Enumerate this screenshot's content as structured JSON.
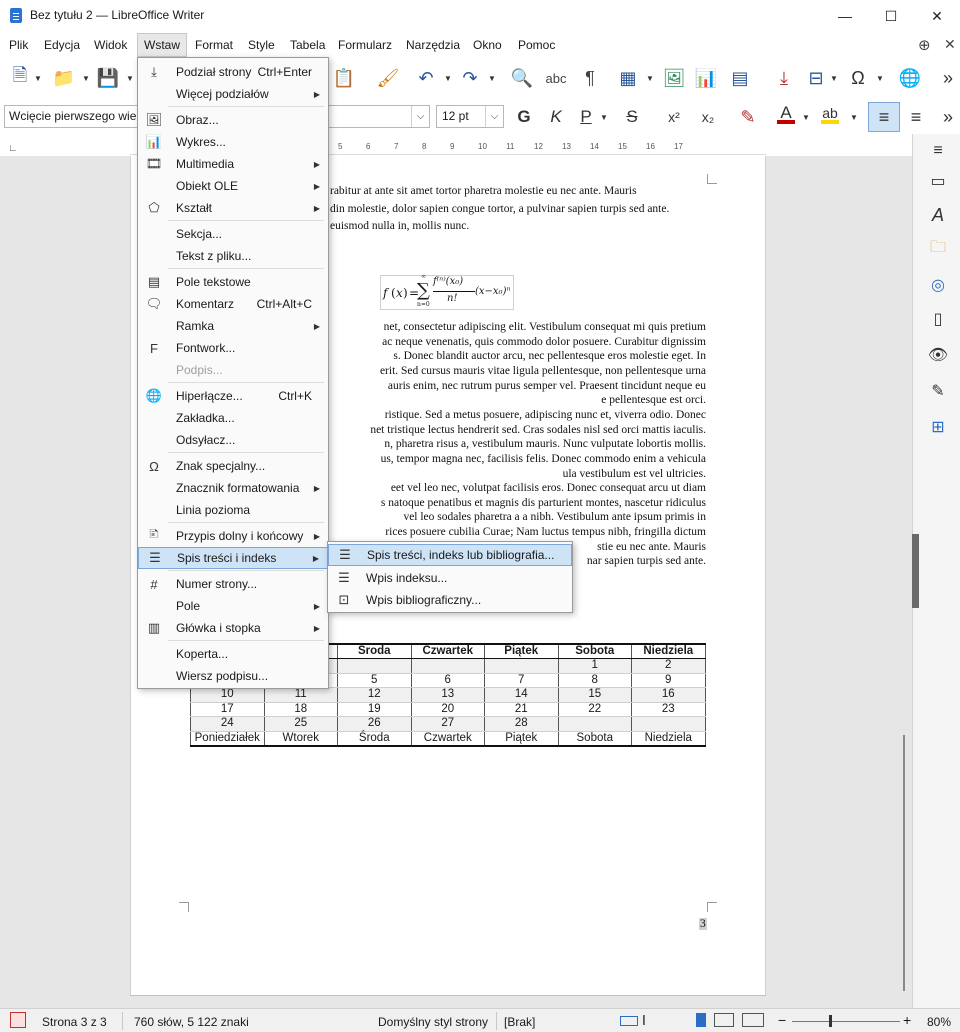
{
  "window": {
    "title": "Bez tytułu 2 — LibreOffice Writer",
    "controls": {
      "minimize": "—",
      "maximize": "☐",
      "close": "✕"
    }
  },
  "menubar": {
    "items": [
      "Plik",
      "Edycja",
      "Widok",
      "Wstaw",
      "Format",
      "Style",
      "Tabela",
      "Formularz",
      "Narzędzia",
      "Okno",
      "Pomoc"
    ],
    "active": "Wstaw"
  },
  "formatting": {
    "paragraph_style": "Wcięcie pierwszego wiersza",
    "font_size": "12 pt",
    "bold": "G",
    "italic": "K",
    "underline": "P",
    "strike": "S",
    "superscript": "x²",
    "subscript": "x₂",
    "font_color": "#c00000",
    "highlight_color": "#ffd700"
  },
  "ruler": {
    "numbers": [
      "5",
      "6",
      "7",
      "8",
      "9",
      "10",
      "11",
      "12",
      "13",
      "14",
      "15",
      "16",
      "17"
    ]
  },
  "document": {
    "para1": [
      "rabitur at ante sit amet tortor pharetra molestie eu nec ante. Mauris",
      "din molestie, dolor sapien congue tortor, a pulvinar sapien turpis sed ante.",
      "euismod nulla in, mollis nunc."
    ],
    "para2": [
      "net, consectetur adipiscing elit. Vestibulum consequat mi quis pretium",
      "ac neque venenatis, quis commodo dolor posuere. Curabitur dignissim",
      "s. Donec blandit auctor arcu, nec pellentesque eros molestie eget. In",
      "erit. Sed cursus mauris vitae ligula pellentesque, non pellentesque urna",
      "auris enim, nec rutrum purus semper vel. Praesent tincidunt neque eu",
      "e pellentesque est orci.",
      "ristique. Sed a metus posuere, adipiscing nunc et, viverra odio. Donec",
      "net tristique lectus hendrerit sed. Cras sodales nisl sed orci mattis iaculis.",
      "n, pharetra risus a, vestibulum mauris. Nunc vulputate lobortis mollis.",
      "us, tempor magna nec, facilisis felis. Donec commodo enim a vehicula",
      "ula vestibulum est vel ultricies.",
      "eet vel leo nec, volutpat facilisis eros. Donec consequat arcu ut diam",
      "s natoque penatibus et magnis dis parturient montes, nascetur ridiculus",
      "vel leo sodales pharetra a a nibh. Vestibulum ante ipsum primis in",
      "rices posuere cubilia Curae; Nam luctus tempus nibh, fringilla dictum",
      "stie eu nec ante. Mauris",
      "nar sapien turpis sed ante."
    ],
    "formula": {
      "f": "f",
      "x": "x",
      "eq": "=",
      "sum": "∑",
      "sum_top": "∞",
      "sum_bottom": "n=0",
      "num": "f⁽ⁿ⁾(x₀)",
      "den": "n!",
      "tail": "(x−x₀)ⁿ"
    },
    "page_number": "3",
    "calendar": {
      "header": [
        "",
        "",
        "Środa",
        "Czwartek",
        "Piątek",
        "Sobota",
        "Niedziela"
      ],
      "rows": [
        [
          "",
          "",
          "",
          "",
          "",
          "1",
          "2"
        ],
        [
          "",
          "",
          "5",
          "6",
          "7",
          "8",
          "9"
        ],
        [
          "10",
          "11",
          "12",
          "13",
          "14",
          "15",
          "16"
        ],
        [
          "17",
          "18",
          "19",
          "20",
          "21",
          "22",
          "23"
        ],
        [
          "24",
          "25",
          "26",
          "27",
          "28",
          "",
          ""
        ]
      ],
      "footer": [
        "Poniedziałek",
        "Wtorek",
        "Środa",
        "Czwartek",
        "Piątek",
        "Sobota",
        "Niedziela"
      ]
    }
  },
  "insert_menu": {
    "items": [
      {
        "label": "Podział strony",
        "shortcut": "Ctrl+Enter",
        "icon": "page-break-icon"
      },
      {
        "label": "Więcej podziałów",
        "submenu": true
      },
      {
        "label": "Obraz...",
        "icon": "image-icon"
      },
      {
        "label": "Wykres...",
        "icon": "chart-icon"
      },
      {
        "label": "Multimedia",
        "submenu": true,
        "icon": "media-icon"
      },
      {
        "label": "Obiekt OLE",
        "submenu": true
      },
      {
        "label": "Kształt",
        "submenu": true,
        "icon": "shape-icon"
      },
      {
        "label": "Sekcja..."
      },
      {
        "label": "Tekst z pliku..."
      },
      {
        "label": "Pole tekstowe",
        "icon": "textbox-icon"
      },
      {
        "label": "Komentarz",
        "shortcut": "Ctrl+Alt+C",
        "icon": "comment-icon"
      },
      {
        "label": "Ramka",
        "submenu": true
      },
      {
        "label": "Fontwork...",
        "icon": "fontwork-icon"
      },
      {
        "label": "Podpis...",
        "disabled": true
      },
      {
        "label": "Hiperłącze...",
        "shortcut": "Ctrl+K",
        "icon": "hyperlink-icon"
      },
      {
        "label": "Zakładka..."
      },
      {
        "label": "Odsyłacz..."
      },
      {
        "label": "Znak specjalny...",
        "icon": "omega-icon"
      },
      {
        "label": "Znacznik formatowania",
        "submenu": true
      },
      {
        "label": "Linia pozioma"
      },
      {
        "label": "Przypis dolny i końcowy",
        "submenu": true,
        "icon": "footnote-icon"
      },
      {
        "label": "Spis treści i indeks",
        "submenu": true,
        "icon": "toc-icon",
        "highlighted": true
      },
      {
        "label": "Numer strony...",
        "icon": "page-number-icon"
      },
      {
        "label": "Pole",
        "submenu": true
      },
      {
        "label": "Główka i stopka",
        "submenu": true,
        "icon": "header-footer-icon"
      },
      {
        "label": "Koperta..."
      },
      {
        "label": "Wiersz podpisu..."
      }
    ]
  },
  "toc_submenu": {
    "items": [
      {
        "label": "Spis treści, indeks lub bibliografia...",
        "icon": "toc-icon",
        "highlighted": true
      },
      {
        "label": "Wpis indeksu...",
        "icon": "index-entry-icon"
      },
      {
        "label": "Wpis bibliograficzny...",
        "icon": "bibliography-icon"
      }
    ]
  },
  "statusbar": {
    "page": "Strona 3 z 3",
    "words": "760 słów, 5 122 znaki",
    "page_style": "Domyślny styl strony",
    "language": "[Brak]",
    "zoom": "80%",
    "zoom_minus": "−",
    "zoom_plus": "+"
  }
}
